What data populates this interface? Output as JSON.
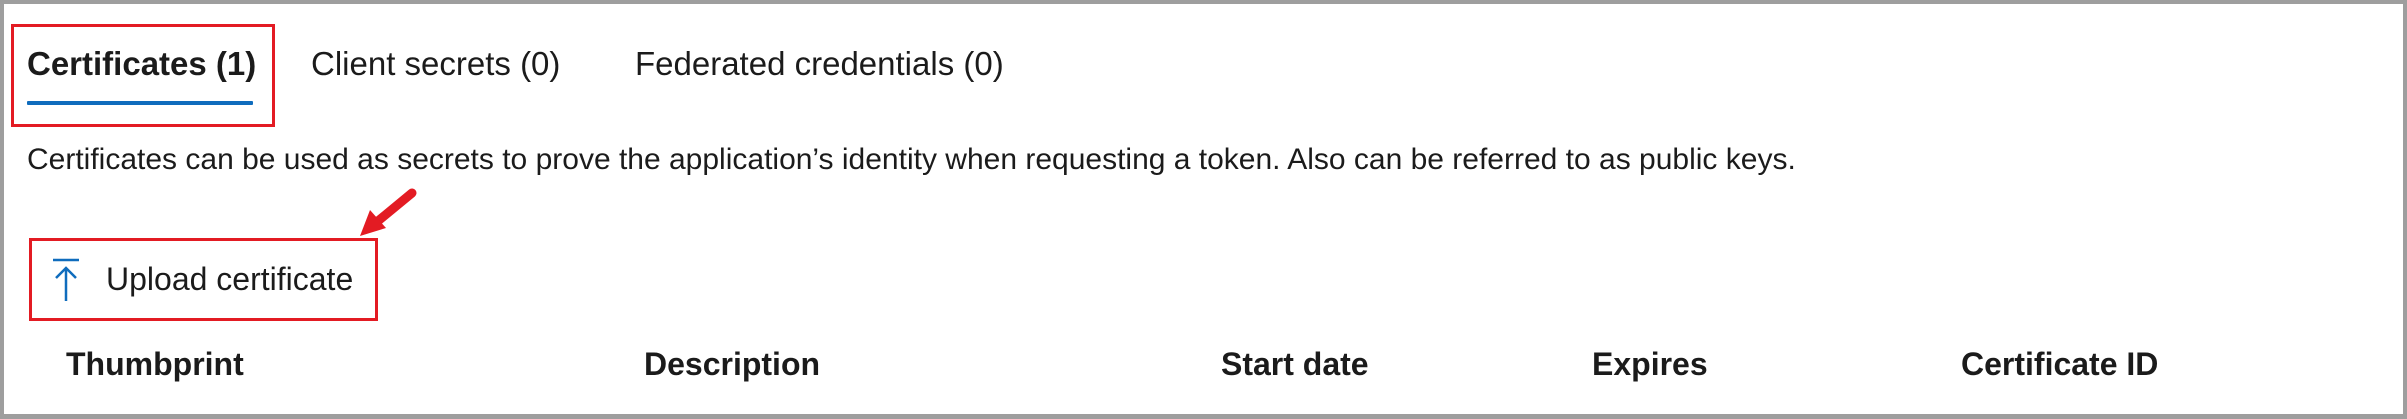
{
  "tabs": [
    {
      "label": "Certificates (1)",
      "selected": true
    },
    {
      "label": "Client secrets (0)",
      "selected": false
    },
    {
      "label": "Federated credentials (0)",
      "selected": false
    }
  ],
  "description": "Certificates can be used as secrets to prove the application’s identity when requesting a token. Also can be referred to as public keys.",
  "toolbar": {
    "upload_label": "Upload certificate",
    "upload_icon": "upload-icon"
  },
  "table": {
    "columns": [
      "Thumbprint",
      "Description",
      "Start date",
      "Expires",
      "Certificate ID"
    ]
  },
  "colors": {
    "accent": "#0f6cbd",
    "highlight": "#e31b23",
    "text": "#1b1b1b",
    "frame": "#9e9e9e"
  }
}
